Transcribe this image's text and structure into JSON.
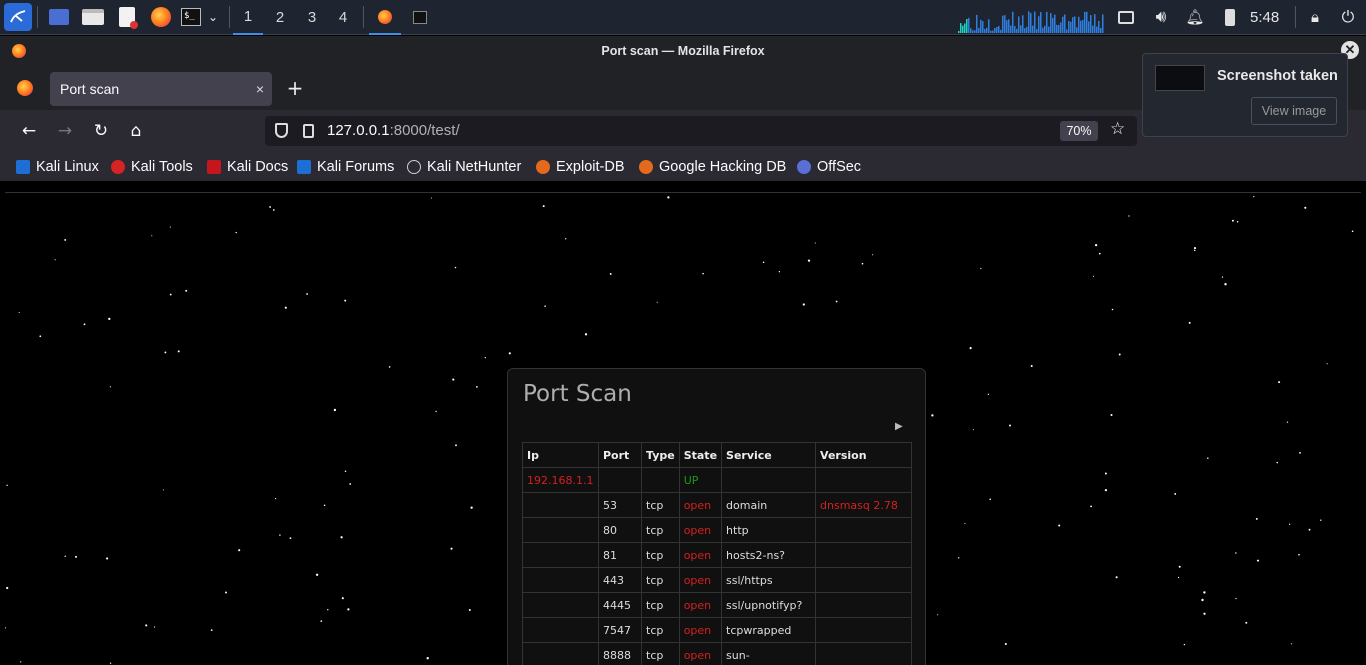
{
  "taskbar": {
    "workspaces": [
      "1",
      "2",
      "3",
      "4"
    ],
    "clock": "5:48",
    "icons": [
      "kali-menu-icon",
      "show-desktop-icon",
      "file-manager-icon",
      "text-editor-icon",
      "firefox-icon",
      "terminal-icon"
    ]
  },
  "window": {
    "title": "Port scan — Mozilla Firefox"
  },
  "browser": {
    "tab_title": "Port scan",
    "tab_close": "×",
    "new_tab": "+",
    "url_host": "127.0.0.1",
    "url_path": ":8000/test/",
    "zoom": "70%",
    "bookmarks": [
      {
        "label": "Kali Linux",
        "color": "#1d6fd6"
      },
      {
        "label": "Kali Tools",
        "color": "#d62424"
      },
      {
        "label": "Kali Docs",
        "color": "#c4161c"
      },
      {
        "label": "Kali Forums",
        "color": "#1d6fd6"
      },
      {
        "label": "Kali NetHunter",
        "color": "#cfcfcf"
      },
      {
        "label": "Exploit-DB",
        "color": "#e36a1c"
      },
      {
        "label": "Google Hacking DB",
        "color": "#e36a1c"
      },
      {
        "label": "OffSec",
        "color": "#5a6fd6"
      }
    ]
  },
  "page": {
    "heading": "Port Scan",
    "table": {
      "headers": [
        "Ip",
        "Port",
        "Type",
        "State",
        "Service",
        "Version"
      ],
      "host_row": {
        "ip": "192.168.1.1",
        "state": "UP"
      },
      "rows": [
        {
          "port": "53",
          "type": "tcp",
          "state": "open",
          "service": "domain",
          "version": "dnsmasq 2.78"
        },
        {
          "port": "80",
          "type": "tcp",
          "state": "open",
          "service": "http",
          "version": ""
        },
        {
          "port": "81",
          "type": "tcp",
          "state": "open",
          "service": "hosts2-ns?",
          "version": ""
        },
        {
          "port": "443",
          "type": "tcp",
          "state": "open",
          "service": "ssl/https",
          "version": ""
        },
        {
          "port": "4445",
          "type": "tcp",
          "state": "open",
          "service": "ssl/upnotifyp?",
          "version": ""
        },
        {
          "port": "7547",
          "type": "tcp",
          "state": "open",
          "service": "tcpwrapped",
          "version": ""
        },
        {
          "port": "8888",
          "type": "tcp",
          "state": "open",
          "service": "sun-",
          "version": ""
        }
      ]
    }
  },
  "notification": {
    "title": "Screenshot taken",
    "action": "View image"
  },
  "colors": {
    "taskbar_bg": "#1e2430",
    "accent": "#3d8ee6",
    "error_red": "#d42020",
    "up_green": "#1a9a1a"
  }
}
